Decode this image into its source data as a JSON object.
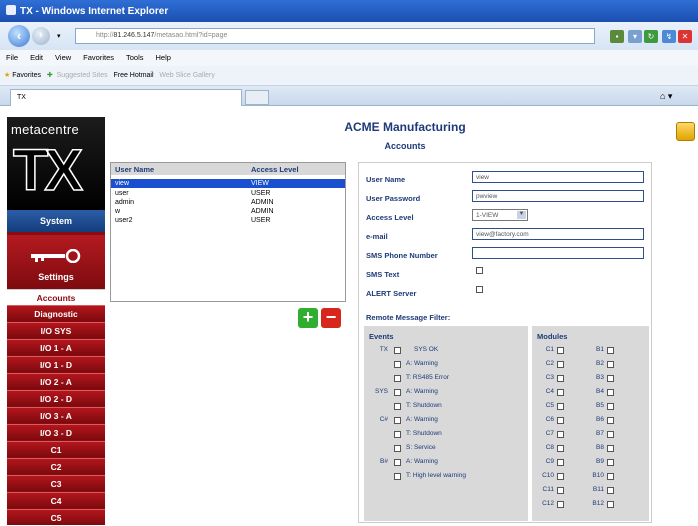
{
  "window": {
    "title": "TX - Windows Internet Explorer"
  },
  "browser": {
    "address_prefix": "http://",
    "address_host": "81.246.5.147",
    "address_rest": "/metasao.html?id=page",
    "menu": [
      "File",
      "Edit",
      "View",
      "Favorites",
      "Tools",
      "Help"
    ],
    "favorites_label": "Favorites",
    "fav_links": [
      "Suggested Sites",
      "Free Hotmail",
      "Web Slice Gallery"
    ],
    "tab_title": "TX"
  },
  "sidebar": {
    "brand": "metacentre",
    "logo_text": "TX",
    "system_label": "System",
    "settings_label": "Settings",
    "items": [
      "Accounts",
      "Diagnostic",
      "I/O SYS",
      "I/O 1 - A",
      "I/O 1 - D",
      "I/O 2 - A",
      "I/O 2 - D",
      "I/O 3 - A",
      "I/O 3 - D",
      "C1",
      "C2",
      "C3",
      "C4",
      "C5"
    ],
    "active_item": "Accounts"
  },
  "page": {
    "title": "ACME Manufacturing",
    "subtitle": "Accounts"
  },
  "users": {
    "headers": [
      "User Name",
      "Access Level"
    ],
    "rows": [
      {
        "name": "view",
        "level": "VIEW"
      },
      {
        "name": "user",
        "level": "USER"
      },
      {
        "name": "admin",
        "level": "ADMIN"
      },
      {
        "name": "w",
        "level": "ADMIN"
      },
      {
        "name": "user2",
        "level": "USER"
      }
    ],
    "add_label": "+",
    "remove_label": "−"
  },
  "form": {
    "username_label": "User Name",
    "username_value": "view",
    "password_label": "User Password",
    "password_value": "pwview",
    "access_label": "Access Level",
    "access_value": "1-VIEW",
    "email_label": "e-mail",
    "email_value": "view@factory.com",
    "sms_phone_label": "SMS Phone Number",
    "sms_phone_value": "",
    "sms_text_label": "SMS Text",
    "alert_label": "ALERT Server",
    "filter_label": "Remote Message Filter:"
  },
  "events": {
    "header": "Events",
    "lines": [
      {
        "group": "TX",
        "label": "SYS OK"
      },
      {
        "group": "",
        "label": "A: Warning"
      },
      {
        "group": "",
        "label": "T: RS485 Error"
      },
      {
        "group": "SYS",
        "label": "A: Warning"
      },
      {
        "group": "",
        "label": "T: Shutdown"
      },
      {
        "group": "C#",
        "label": "A: Warning"
      },
      {
        "group": "",
        "label": "T: Shutdown"
      },
      {
        "group": "",
        "label": "S: Service"
      },
      {
        "group": "B#",
        "label": "A: Warning"
      },
      {
        "group": "",
        "label": "T: High level warning"
      }
    ]
  },
  "modules": {
    "header": "Modules",
    "pairs": [
      [
        "C1",
        "B1"
      ],
      [
        "C2",
        "B2"
      ],
      [
        "C3",
        "B3"
      ],
      [
        "C4",
        "B4"
      ],
      [
        "C5",
        "B5"
      ],
      [
        "C6",
        "B6"
      ],
      [
        "C7",
        "B7"
      ],
      [
        "C8",
        "B8"
      ],
      [
        "C9",
        "B9"
      ],
      [
        "C10",
        "B10"
      ],
      [
        "C11",
        "B11"
      ],
      [
        "C12",
        "B12"
      ]
    ]
  },
  "colors": {
    "sidebar": "#8a0c12",
    "heading": "#1e3a78",
    "selection": "#1a4fd0",
    "add": "#2fae2f",
    "remove": "#d9261c"
  }
}
